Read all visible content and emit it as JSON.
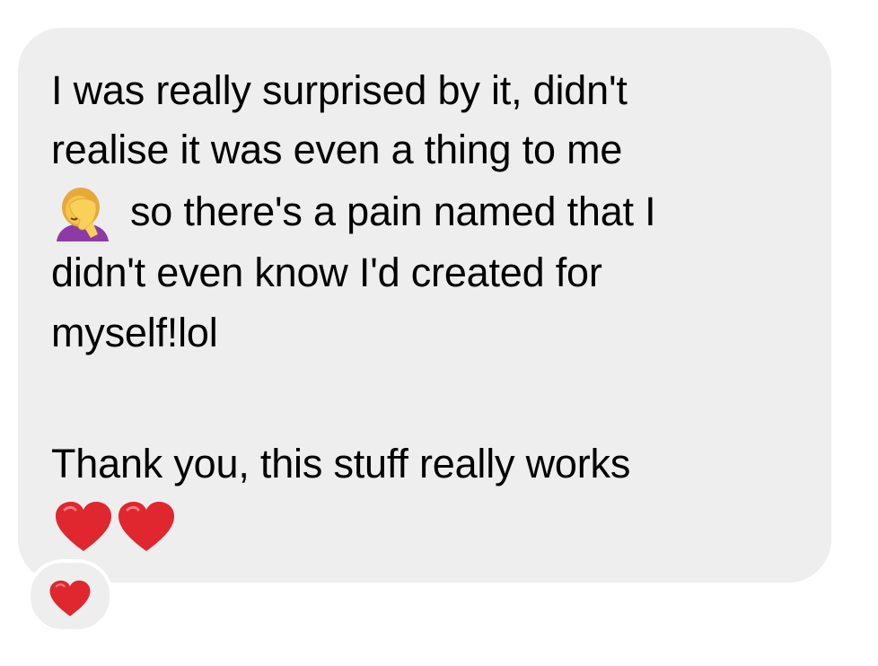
{
  "message": {
    "lines": [
      "I was really surprised by it, didn't",
      "realise it was even a thing to me",
      "so there's a pain named that I",
      "didn't even know I'd created for",
      "myself!lol",
      "Thank you, this stuff really works"
    ],
    "inline_icons": [
      "face-palm-emoji-icon",
      "red-heart-emoji-icon",
      "red-heart-emoji-icon"
    ]
  },
  "reaction": {
    "icon": "red-heart-emoji-icon"
  },
  "colors": {
    "bubble": "#eeeeef",
    "text": "#000000",
    "heart": "#e0262e"
  }
}
